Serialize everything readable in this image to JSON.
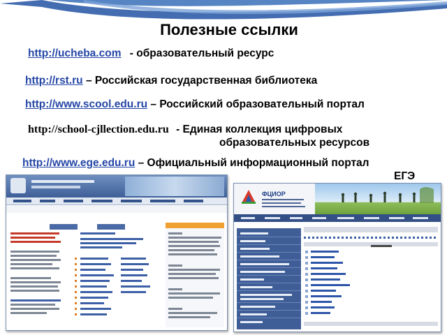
{
  "slide": {
    "title": "Полезные ссылки",
    "links": [
      {
        "url": "http://ucheba.com",
        "desc": " - образовательный ресурс"
      },
      {
        "url": "http://rst.ru",
        "desc": " – Российская государственная библиотека"
      },
      {
        "url": "http://www.scool.edu.ru",
        "desc": " – Российский образовательный портал"
      },
      {
        "url": "http://school-cjllection.edu.ru",
        "desc_line1": " - Единая коллекция цифровых",
        "desc_line2": "образовательных ресурсов"
      },
      {
        "url": "http://www.ege.edu.ru",
        "desc_line1": " – Официальный информационный портал",
        "desc_line2": "ЕГЭ"
      }
    ]
  },
  "screenshots": {
    "second_logo_text": "ФЦИОР"
  },
  "colors": {
    "link": "#2547a6",
    "swoosh": "#3a6fb8",
    "site_blue": "#3f5e97"
  }
}
